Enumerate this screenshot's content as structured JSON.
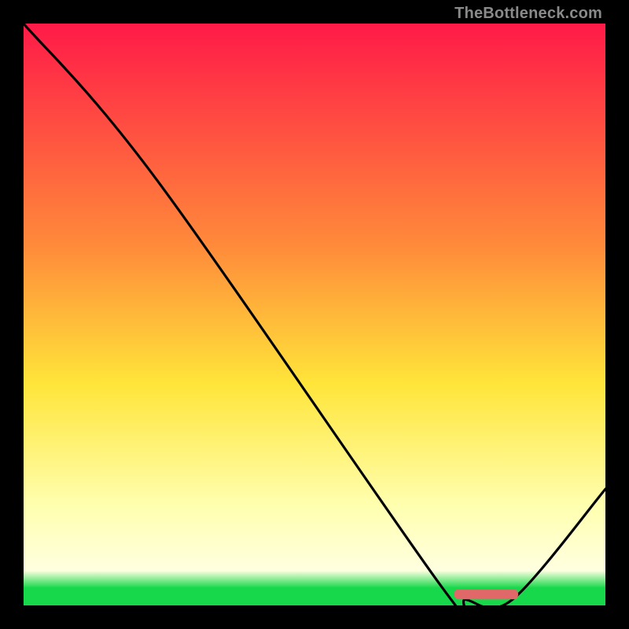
{
  "attribution": "TheBottleneck.com",
  "colors": {
    "top": "#ff1a48",
    "mid_orange": "#ff8a3a",
    "mid_yellow": "#ffe53a",
    "pale_yellow": "#ffffb0",
    "green": "#17d84a",
    "curve": "#000000",
    "marker": "#e06868",
    "frame": "#000000"
  },
  "chart_data": {
    "type": "line",
    "title": "",
    "xlabel": "",
    "ylabel": "",
    "xlim": [
      0,
      100
    ],
    "ylim": [
      0,
      100
    ],
    "gradient_stops": [
      {
        "pct": 0,
        "color": "#ff1a48"
      },
      {
        "pct": 38,
        "color": "#ff8a3a"
      },
      {
        "pct": 62,
        "color": "#ffe53a"
      },
      {
        "pct": 83,
        "color": "#ffffb0"
      },
      {
        "pct": 94,
        "color": "#ffffe0"
      },
      {
        "pct": 97,
        "color": "#17d84a"
      },
      {
        "pct": 100,
        "color": "#17d84a"
      }
    ],
    "series": [
      {
        "name": "bottleneck-curve",
        "x": [
          0,
          23,
          72,
          76,
          84,
          100
        ],
        "values": [
          100,
          73,
          3,
          1,
          1,
          20
        ]
      }
    ],
    "marker": {
      "name": "optimal-range",
      "x_start": 74,
      "x_end": 85,
      "y": 2
    }
  }
}
